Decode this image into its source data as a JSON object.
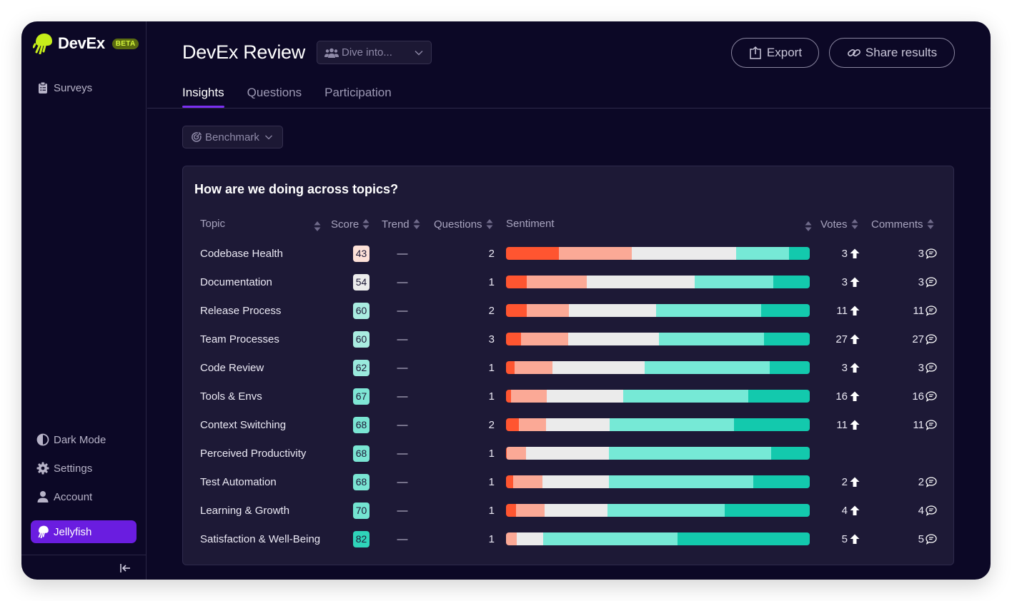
{
  "app": {
    "name": "DevEx",
    "badge": "BETA",
    "brand_color": "#c6ee1a",
    "accent_color": "#6a1de0"
  },
  "sidebar": {
    "top_items": [
      {
        "label": "Surveys",
        "icon": "clipboard-icon"
      }
    ],
    "bottom_items": [
      {
        "label": "Dark Mode",
        "icon": "contrast-icon"
      },
      {
        "label": "Settings",
        "icon": "gear-icon"
      },
      {
        "label": "Account",
        "icon": "user-icon"
      }
    ],
    "org_button": {
      "label": "Jellyfish",
      "icon": "jellyfish-icon"
    },
    "collapse_icon": "collapse-left-icon"
  },
  "header": {
    "title": "DevEx Review",
    "dive_select": {
      "placeholder": "Dive into...",
      "icon": "users-icon"
    },
    "export_label": "Export",
    "share_label": "Share results"
  },
  "tabs": [
    {
      "label": "Insights",
      "active": true
    },
    {
      "label": "Questions",
      "active": false
    },
    {
      "label": "Participation",
      "active": false
    }
  ],
  "filter": {
    "benchmark_label": "Benchmark"
  },
  "card": {
    "title": "How are we doing across topics?",
    "columns": {
      "topic": "Topic",
      "score": "Score",
      "trend": "Trend",
      "questions": "Questions",
      "sentiment": "Sentiment",
      "votes": "Votes",
      "comments": "Comments"
    },
    "sentiment_colors": [
      "#ff5530",
      "#fba996",
      "#ebebeb",
      "#76e9d6",
      "#13c9ad"
    ],
    "rows": [
      {
        "topic": "Codebase Health",
        "score": "43",
        "score_color": "#fde1d8",
        "trend": "—",
        "questions": "2",
        "sentiment": [
          17.4,
          24.0,
          34.3,
          17.4,
          6.9
        ],
        "votes": "3",
        "comments": "3"
      },
      {
        "topic": "Documentation",
        "score": "54",
        "score_color": "#ececec",
        "trend": "—",
        "questions": "1",
        "sentiment": [
          6.9,
          19.7,
          35.5,
          26.0,
          11.9
        ],
        "votes": "3",
        "comments": "3"
      },
      {
        "topic": "Release Process",
        "score": "60",
        "score_color": "#a9ece1",
        "trend": "—",
        "questions": "2",
        "sentiment": [
          6.9,
          13.8,
          28.6,
          34.8,
          15.9
        ],
        "votes": "11",
        "comments": "11"
      },
      {
        "topic": "Team Processes",
        "score": "60",
        "score_color": "#a9ece1",
        "trend": "—",
        "questions": "3",
        "sentiment": [
          4.9,
          15.6,
          29.8,
          34.7,
          15.0
        ],
        "votes": "27",
        "comments": "27"
      },
      {
        "topic": "Code Review",
        "score": "62",
        "score_color": "#9aeadd",
        "trend": "—",
        "questions": "1",
        "sentiment": [
          2.9,
          12.4,
          30.4,
          41.1,
          13.2
        ],
        "votes": "3",
        "comments": "3"
      },
      {
        "topic": "Tools & Envs",
        "score": "67",
        "score_color": "#7fe6d5",
        "trend": "—",
        "questions": "1",
        "sentiment": [
          1.6,
          11.7,
          25.3,
          41.2,
          20.2
        ],
        "votes": "16",
        "comments": "16"
      },
      {
        "topic": "Context Switching",
        "score": "68",
        "score_color": "#7ae5d3",
        "trend": "—",
        "questions": "2",
        "sentiment": [
          4.2,
          8.9,
          21.1,
          40.9,
          24.9
        ],
        "votes": "11",
        "comments": "11"
      },
      {
        "topic": "Perceived Productivity",
        "score": "68",
        "score_color": "#7ae5d3",
        "trend": "—",
        "questions": "1",
        "sentiment": [
          0.3,
          6.2,
          27.5,
          53.3,
          12.7
        ],
        "votes": "",
        "comments": ""
      },
      {
        "topic": "Test Automation",
        "score": "68",
        "score_color": "#7ae5d3",
        "trend": "—",
        "questions": "1",
        "sentiment": [
          2.4,
          9.5,
          22.1,
          47.4,
          18.6
        ],
        "votes": "2",
        "comments": "2"
      },
      {
        "topic": "Learning & Growth",
        "score": "70",
        "score_color": "#73e4d1",
        "trend": "—",
        "questions": "1",
        "sentiment": [
          3.4,
          9.4,
          20.7,
          38.5,
          28.0
        ],
        "votes": "4",
        "comments": "4"
      },
      {
        "topic": "Satisfaction & Well-Being",
        "score": "82",
        "score_color": "#2fd4ba",
        "trend": "—",
        "questions": "1",
        "sentiment": [
          0,
          3.5,
          8.8,
          44.2,
          43.5
        ],
        "votes": "5",
        "comments": "5"
      }
    ]
  }
}
